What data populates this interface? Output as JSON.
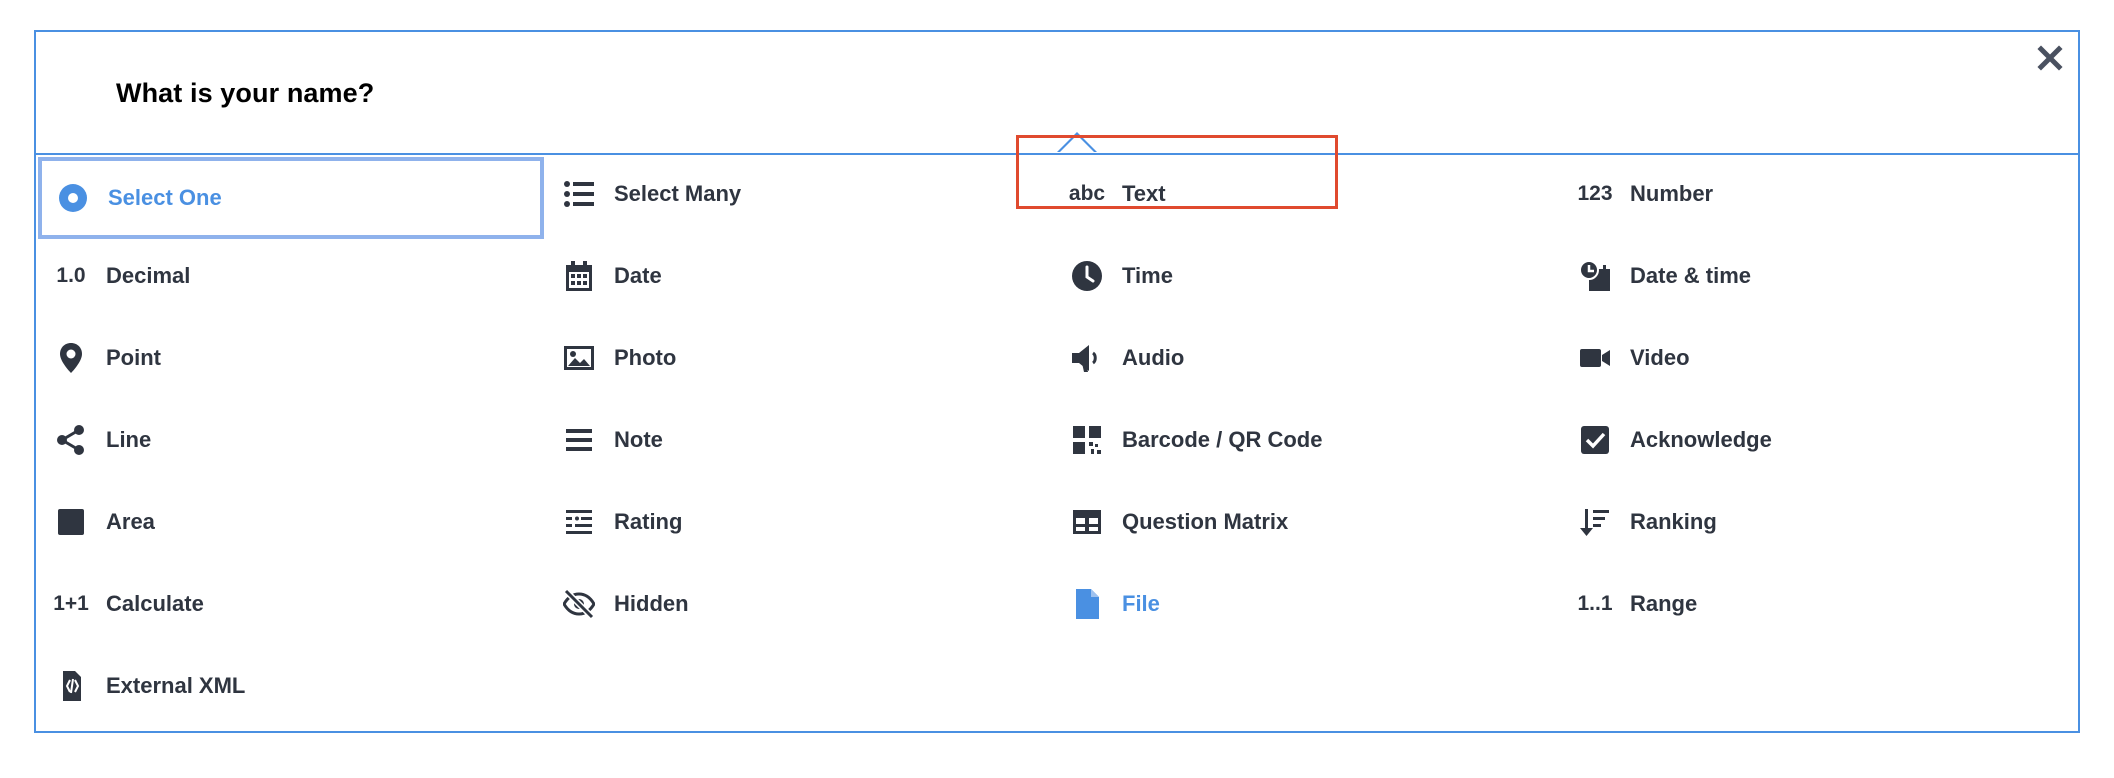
{
  "dialog": {
    "title": "What is your name?",
    "close_label": "✕"
  },
  "items": [
    {
      "label": "Select One",
      "icon": "radio-icon"
    },
    {
      "label": "Select Many",
      "icon": "list-icon"
    },
    {
      "label": "Text",
      "icon": "abc-icon",
      "glyph": "abc"
    },
    {
      "label": "Number",
      "icon": "number-icon",
      "glyph": "123"
    },
    {
      "label": "Decimal",
      "icon": "decimal-icon",
      "glyph": "1.0"
    },
    {
      "label": "Date",
      "icon": "calendar-icon"
    },
    {
      "label": "Time",
      "icon": "clock-icon"
    },
    {
      "label": "Date & time",
      "icon": "date-time-icon"
    },
    {
      "label": "Point",
      "icon": "map-pin-icon"
    },
    {
      "label": "Photo",
      "icon": "image-icon"
    },
    {
      "label": "Audio",
      "icon": "speaker-icon"
    },
    {
      "label": "Video",
      "icon": "video-camera-icon"
    },
    {
      "label": "Line",
      "icon": "share-icon"
    },
    {
      "label": "Note",
      "icon": "lines-icon"
    },
    {
      "label": "Barcode / QR Code",
      "icon": "qr-code-icon"
    },
    {
      "label": "Acknowledge",
      "icon": "checkbox-icon"
    },
    {
      "label": "Area",
      "icon": "square-icon"
    },
    {
      "label": "Rating",
      "icon": "rating-icon"
    },
    {
      "label": "Question Matrix",
      "icon": "table-icon"
    },
    {
      "label": "Ranking",
      "icon": "sort-icon"
    },
    {
      "label": "Calculate",
      "icon": "calculate-icon",
      "glyph": "1+1"
    },
    {
      "label": "Hidden",
      "icon": "eye-off-icon"
    },
    {
      "label": "File",
      "icon": "file-icon"
    },
    {
      "label": "Range",
      "icon": "range-icon",
      "glyph": "1..1"
    },
    {
      "label": "External XML",
      "icon": "xml-file-icon"
    }
  ],
  "colors": {
    "accent": "#4a90e2",
    "highlight": "#e04a2f",
    "icon": "#2f3540",
    "selected_outline": "#8fb2ec"
  }
}
